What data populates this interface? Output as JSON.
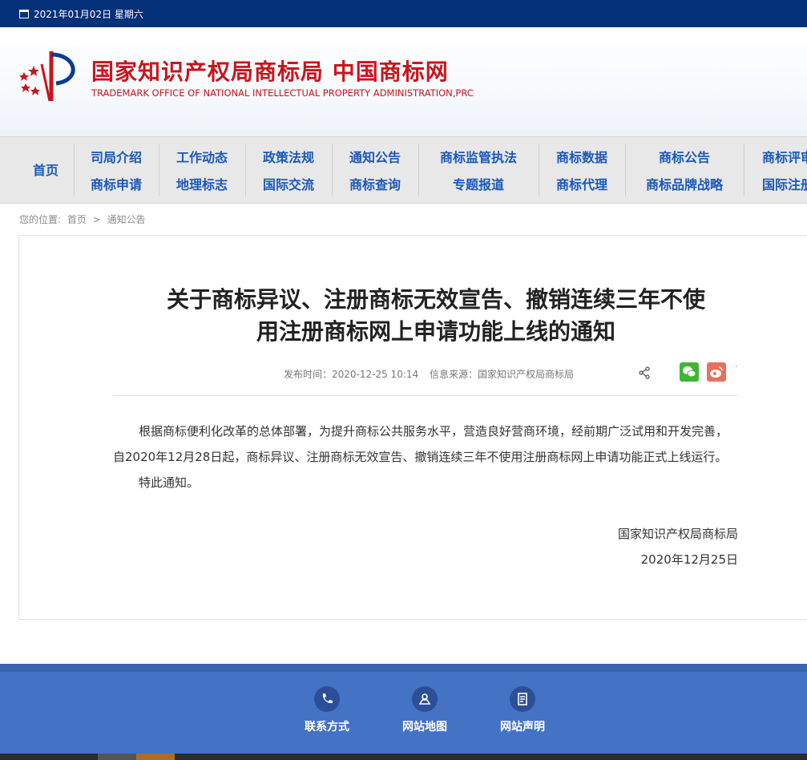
{
  "topbar": {
    "date": "2021年01月02日 星期六"
  },
  "header": {
    "title": "国家知识产权局商标局 中国商标网",
    "subtitle": "TRADEMARK OFFICE OF NATIONAL INTELLECTUAL PROPERTY ADMINISTRATION,PRC"
  },
  "nav": {
    "home": "首页",
    "columns": [
      {
        "top": "司局介绍",
        "bottom": "商标申请"
      },
      {
        "top": "工作动态",
        "bottom": "地理标志"
      },
      {
        "top": "政策法规",
        "bottom": "国际交流"
      },
      {
        "top": "通知公告",
        "bottom": "商标查询"
      },
      {
        "top": "商标监管执法",
        "bottom": "专题报道"
      },
      {
        "top": "商标数据",
        "bottom": "商标代理"
      },
      {
        "top": "商标公告",
        "bottom": "商标品牌战略"
      },
      {
        "top": "商标评审",
        "bottom": "国际注册"
      }
    ]
  },
  "breadcrumb": {
    "label": "您的位置:",
    "home": "首页",
    "sep": ">",
    "current": "通知公告"
  },
  "article": {
    "title_line1": "关于商标异议、注册商标无效宣告、撤销连续三年不使",
    "title_line2": "用注册商标网上申请功能上线的通知",
    "publish_time": "发布时间：2020-12-25 10:14",
    "source": "信息来源：国家知识产权局商标局",
    "paragraph1": "根据商标便利化改革的总体部署，为提升商标公共服务水平，营造良好营商环境，经前期广泛试用和开发完善，自2020年12月28日起，商标异议、注册商标无效宣告、撤销连续三年不使用注册商标网上申请功能正式上线运行。",
    "paragraph2": "特此通知。",
    "signature": "国家知识产权局商标局",
    "sign_date": "2020年12月25日"
  },
  "share": {
    "icons": [
      "share-icon",
      "wechat-icon",
      "weibo-icon"
    ],
    "dash": "-"
  },
  "footer": {
    "items": [
      {
        "label": "联系方式",
        "icon": "phone-icon"
      },
      {
        "label": "网站地图",
        "icon": "map-icon"
      },
      {
        "label": "网站声明",
        "icon": "document-icon"
      }
    ]
  },
  "colors": {
    "topbar": "#05307a",
    "brand_red": "#c8161d",
    "nav_text": "#1b57b8",
    "footer": "#4472c4"
  }
}
